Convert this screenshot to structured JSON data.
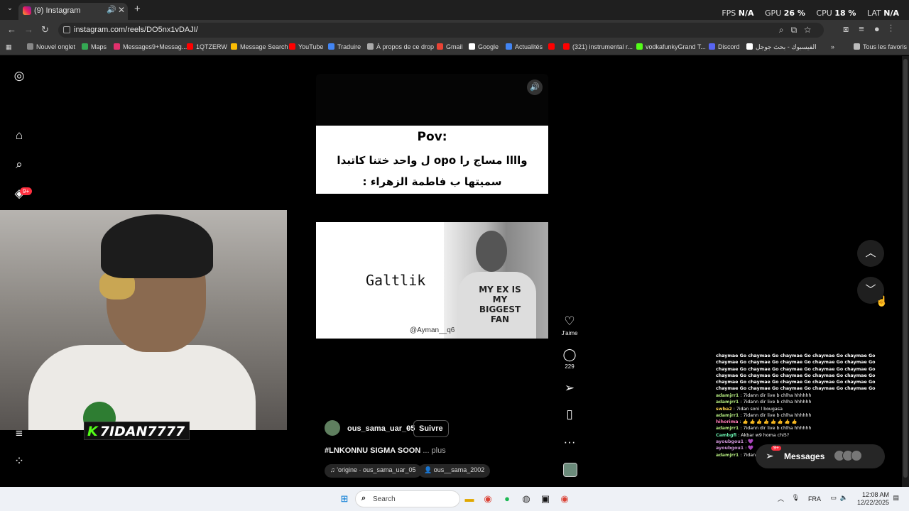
{
  "browser": {
    "tab_title": "(9) Instagram",
    "url": "instagram.com/reels/DO5nx1vDAJI/",
    "bookmarks": [
      "Nouvel onglet",
      "Maps",
      "Messages9+Messag...",
      "1QTZERW",
      "Message Search",
      "YouTube",
      "Traduire",
      "À propos de ce drop",
      "Gmail",
      "Google",
      "Actualités",
      "(321) instrumental r...",
      "vodkafunkyGrand T...",
      "Discord",
      "الفيسبوك - بحث جوجل"
    ],
    "bookmarks_all": "Tous les favoris"
  },
  "overlay": {
    "fps_label": "FPS",
    "fps_value": "N/A",
    "gpu_label": "GPU",
    "gpu_value": "26 %",
    "cpu_label": "CPU",
    "cpu_value": "18 %",
    "lat_label": "LAT",
    "lat_value": "N/A"
  },
  "sidebar": {
    "notifications_badge": "9+"
  },
  "reel": {
    "caption_title": "Pov:",
    "caption_text": "واااا مساج را opo ل واحد ختنا كاتبدا سميتها ب فاطمة الزهراء :",
    "meme_word": "Galtlik",
    "shirt_text": "MY EX IS MY BIGGEST FAN",
    "watermark": "@Ayman__q6",
    "account_name": "ous_sama_uar_05",
    "separator": "•",
    "follow_label": "Suivre",
    "description": "#LNKONNU SIGMA SOON",
    "more_label": "... plus",
    "audio_chip": "'origine · ous_sama_uar_05",
    "collab_chip": "ous__sama_2002"
  },
  "actions": {
    "like_label": "J'aime",
    "comment_count": "229"
  },
  "stream": {
    "streamer_name": "7IDAN7777",
    "streamer_initial": "K",
    "chat_spam": "chaymae Go chaymae Go chaymae Go chaymae Go chaymae Go chaymae Go chaymae Go chaymae Go chaymae Go chaymae Go chaymae Go chaymae Go chaymae Go chaymae Go chaymae Go chaymae Go chaymae Go chaymae Go chaymae Go chaymae Go chaymae Go chaymae Go chaymae Go chaymae Go chaymae Go chaymae Go chaymae Go chaymae Go chaymae Go chaymae Go chaymae Go chaymae Go chaymae Go chaymae Go chaymae Go cha",
    "chat": [
      {
        "user": "adamjrr1",
        "text": ": 7idann dir live b chlha hhhhhh",
        "color": "#b0e57c"
      },
      {
        "user": "adamjrr1",
        "text": ": 7idann dir live b chlha hhhhhh",
        "color": "#b0e57c"
      },
      {
        "user": "swba2",
        "text": ": 7idan soni l bougasa",
        "color": "#ffd54f"
      },
      {
        "user": "adamjrr1",
        "text": ": 7idann dir live b chlha hhhhhh",
        "color": "#b0e57c"
      },
      {
        "user": "hihorima",
        "text": ": 👍 👍 👍 👍 👍 👍 👍 👍",
        "color": "#ff7ab6"
      },
      {
        "user": "adamjrr1",
        "text": ": 7idann dir live b chlha hhhhhh",
        "color": "#b0e57c"
      },
      {
        "user": "Cambgfi",
        "text": ": Akbar w9 homa chi5?",
        "color": "#69f0ae"
      },
      {
        "user": "ayoubgou1",
        "text": ": 💜",
        "color": "#ce93d8"
      },
      {
        "user": "ayoubgou1",
        "text": ": 💜",
        "color": "#ce93d8"
      },
      {
        "user": "adamjrr1",
        "text": ": 7idann dir live b chlha hhhhhh",
        "color": "#b0e57c"
      }
    ]
  },
  "messages": {
    "label": "Messages",
    "badge": "9+"
  },
  "taskbar": {
    "search_placeholder": "Search",
    "language": "FRA",
    "time": "12:08 AM",
    "date": "12/22/2025"
  }
}
